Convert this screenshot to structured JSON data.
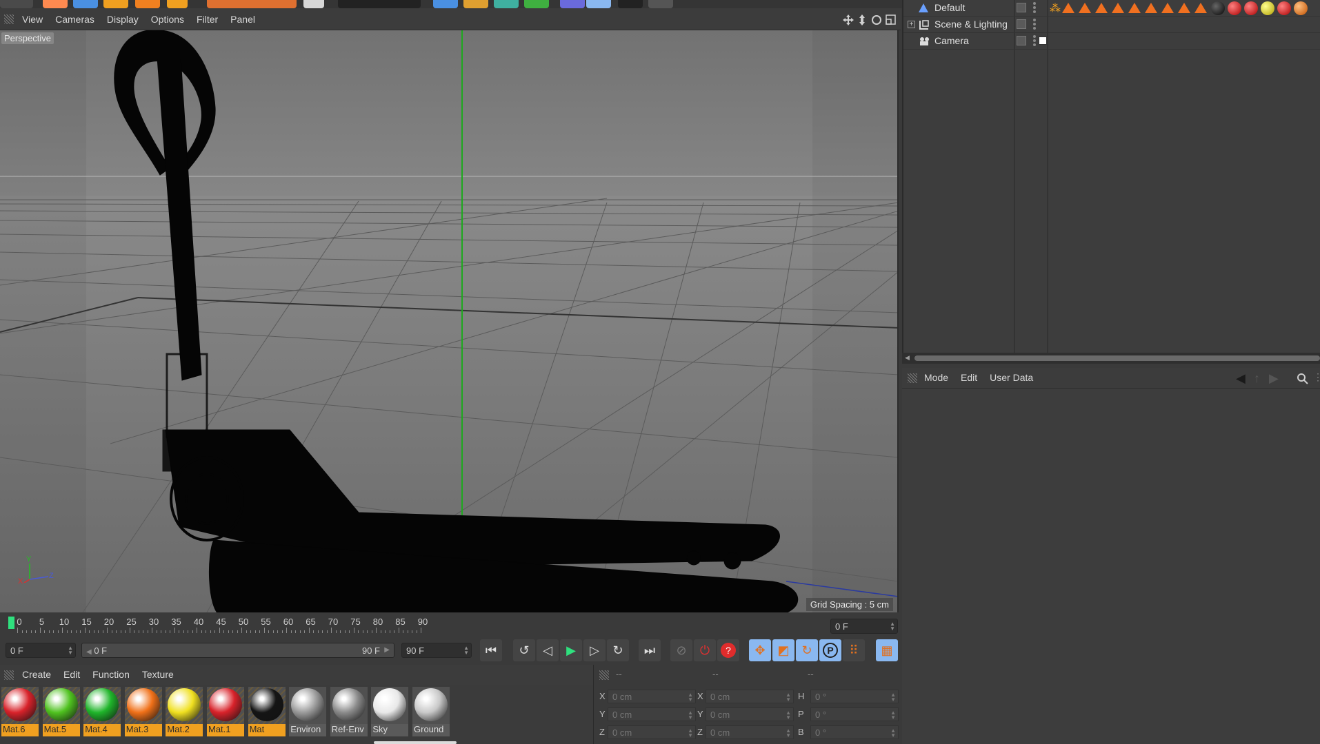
{
  "viewport": {
    "menu": [
      "View",
      "Cameras",
      "Display",
      "Options",
      "Filter",
      "Panel"
    ],
    "label": "Perspective",
    "grid_spacing": "Grid Spacing : 5 cm",
    "axis_labels": {
      "y": "Y",
      "z": "Z",
      "x": "X"
    }
  },
  "timeline": {
    "ticks": [
      "0",
      "5",
      "10",
      "15",
      "20",
      "25",
      "30",
      "35",
      "40",
      "45",
      "50",
      "55",
      "60",
      "65",
      "70",
      "75",
      "80",
      "85",
      "90"
    ],
    "current_frame_field": "0 F",
    "start_field": "0 F",
    "range_start": "0 F",
    "range_end": "90 F",
    "end_field": "90 F"
  },
  "materials": {
    "menu": [
      "Create",
      "Edit",
      "Function",
      "Texture"
    ],
    "items": [
      {
        "name": "Mat.6",
        "color": "#d8222a",
        "selected": true
      },
      {
        "name": "Mat.5",
        "color": "#4fc21f",
        "selected": true
      },
      {
        "name": "Mat.4",
        "color": "#1fb52a",
        "selected": true
      },
      {
        "name": "Mat.3",
        "color": "#f07018",
        "selected": true
      },
      {
        "name": "Mat.2",
        "color": "#f0e020",
        "selected": true
      },
      {
        "name": "Mat.1",
        "color": "#d8222a",
        "selected": true
      },
      {
        "name": "Mat",
        "color": "#151515",
        "selected": true
      },
      {
        "name": "Environ",
        "color": "#9a9a9a",
        "selected": false
      },
      {
        "name": "Ref-Env",
        "color": "#8a8a8a",
        "selected": false
      },
      {
        "name": "Sky",
        "color": "#e8e8e8",
        "selected": false
      },
      {
        "name": "Ground",
        "color": "#c8c8c8",
        "selected": false
      }
    ]
  },
  "coordinates": {
    "headers": [
      "--",
      "--",
      "--"
    ],
    "rows": [
      {
        "a1": "X",
        "v1": "0 cm",
        "a2": "X",
        "v2": "0 cm",
        "a3": "H",
        "v3": "0 °"
      },
      {
        "a1": "Y",
        "v1": "0 cm",
        "a2": "Y",
        "v2": "0 cm",
        "a3": "P",
        "v3": "0 °"
      },
      {
        "a1": "Z",
        "v1": "0 cm",
        "a2": "Z",
        "v2": "0 cm",
        "a3": "B",
        "v3": "0 °"
      }
    ]
  },
  "objects": {
    "items": [
      {
        "name": "Default",
        "icon": "light-icon"
      },
      {
        "name": "Scene & Lighting",
        "icon": "null-object-icon"
      },
      {
        "name": "Camera",
        "icon": "camera-icon"
      }
    ]
  },
  "attributes": {
    "menu": [
      "Mode",
      "Edit",
      "User Data"
    ]
  }
}
